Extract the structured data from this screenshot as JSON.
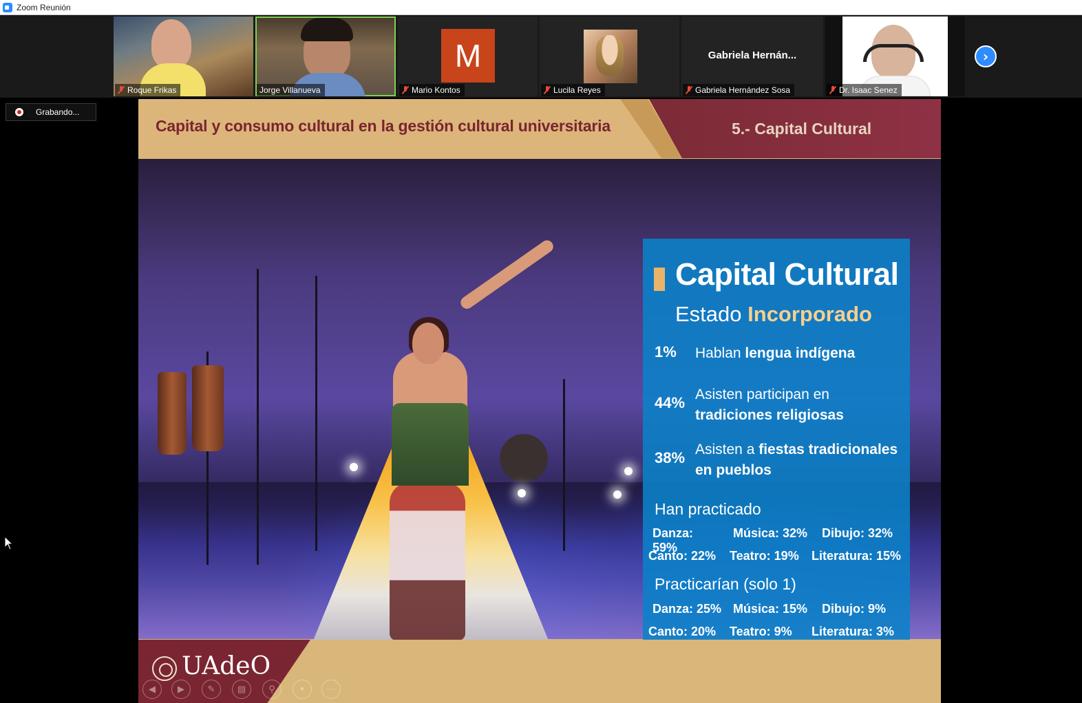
{
  "window": {
    "title": "Zoom Reunión"
  },
  "participants": [
    {
      "name": "Roque Frikas"
    },
    {
      "name": "Jorge Villanueva"
    },
    {
      "name": "Mario Kontos",
      "initial": "M"
    },
    {
      "name": "Lucila Reyes"
    },
    {
      "name": "Gabriela Hernández Sosa",
      "display_name": "Gabriela  Hernán..."
    },
    {
      "name": "Dr. Isaac Senez"
    }
  ],
  "recording": {
    "label": "Grabando..."
  },
  "slide": {
    "title": "Capital y consumo cultural en la gestión cultural universitaria",
    "section": "5.- Capital Cultural",
    "panel": {
      "heading": "Capital Cultural",
      "subheading_plain": "Estado",
      "subheading_accent": "Incorporado",
      "stats": [
        {
          "pct": "1%",
          "plain": "Hablan",
          "bold": "lengua indígena"
        },
        {
          "pct": "44%",
          "plain": "Asisten participan en",
          "bold": "tradiciones religiosas"
        },
        {
          "pct": "38%",
          "plain": "Asisten a",
          "bold": "fiestas tradicionales en pueblos"
        }
      ],
      "practiced": {
        "label": "Han practicado",
        "row1": [
          "Danza: 59%",
          "Música: 32%",
          "Dibujo: 32%"
        ],
        "row2": [
          "Canto: 22%",
          "Teatro: 19%",
          "Literatura: 15%"
        ]
      },
      "would_practice": {
        "label": "Practicarían (solo 1)",
        "row1": [
          "Danza: 25%",
          "Música: 15%",
          "Dibujo: 9%"
        ],
        "row2": [
          "Canto: 20%",
          "Teatro: 9%",
          "Literatura: 3%"
        ]
      }
    },
    "logo": {
      "text": "UAdeO"
    }
  },
  "colors": {
    "accent_blue": "#2d8cff",
    "slide_maroon": "#7a2430",
    "slide_gold": "#d8b579",
    "panel_blue": "#0a82c8",
    "recording_red": "#e02020"
  },
  "icons": {
    "mic_muted": "mic-off-icon",
    "next_page": "chevron-right-icon",
    "recording": "record-icon"
  }
}
